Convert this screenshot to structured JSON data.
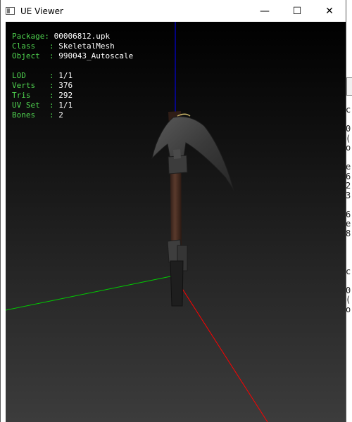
{
  "window": {
    "title": "UE Viewer",
    "controls": {
      "minimize": "—",
      "maximize": "☐",
      "close": "✕"
    }
  },
  "info_top": [
    {
      "key": "Package: ",
      "value": "00006812.upk"
    },
    {
      "key": "Class   : ",
      "value": "SkeletalMesh"
    },
    {
      "key": "Object  : ",
      "value": "990043_Autoscale"
    }
  ],
  "info_bottom": [
    {
      "key": "LOD     : ",
      "value": "1/1"
    },
    {
      "key": "Verts   : ",
      "value": "376"
    },
    {
      "key": "Tris    : ",
      "value": "292"
    },
    {
      "key": "UV Set  : ",
      "value": "1/1"
    },
    {
      "key": "Bones   : ",
      "value": "2"
    }
  ],
  "colors": {
    "label": "#4fd24f",
    "value": "#ffffff",
    "axis_x": "#ff0000",
    "axis_y": "#00cc00",
    "axis_z": "#0000ff"
  },
  "icons": [
    "app-window-icon",
    "minimize-icon",
    "maximize-icon",
    "close-icon"
  ],
  "background_window_text": [
    "c",
    "",
    "0",
    "(",
    "o",
    "",
    "e",
    "6",
    "2",
    "3",
    "",
    "6",
    "e",
    "8",
    "",
    "",
    "",
    "c",
    "",
    "0",
    "(",
    "o"
  ]
}
